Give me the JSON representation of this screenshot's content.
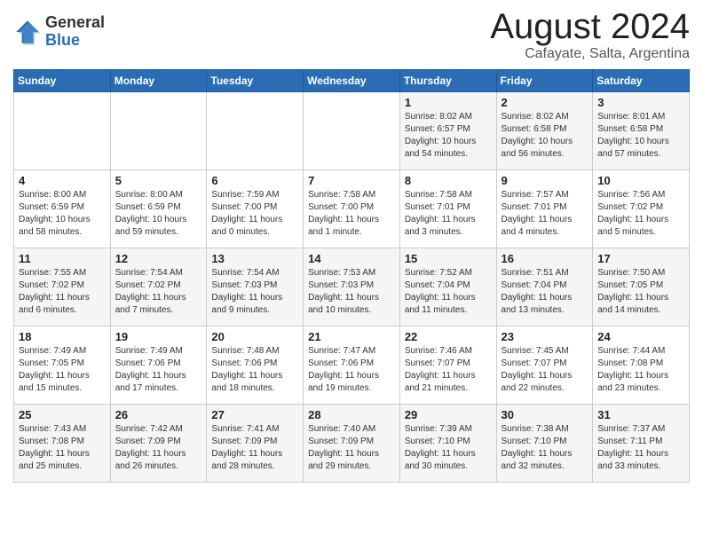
{
  "header": {
    "logo_general": "General",
    "logo_blue": "Blue",
    "month_title": "August 2024",
    "location": "Cafayate, Salta, Argentina"
  },
  "weekdays": [
    "Sunday",
    "Monday",
    "Tuesday",
    "Wednesday",
    "Thursday",
    "Friday",
    "Saturday"
  ],
  "weeks": [
    [
      {
        "day": "",
        "detail": ""
      },
      {
        "day": "",
        "detail": ""
      },
      {
        "day": "",
        "detail": ""
      },
      {
        "day": "",
        "detail": ""
      },
      {
        "day": "1",
        "detail": "Sunrise: 8:02 AM\nSunset: 6:57 PM\nDaylight: 10 hours\nand 54 minutes."
      },
      {
        "day": "2",
        "detail": "Sunrise: 8:02 AM\nSunset: 6:58 PM\nDaylight: 10 hours\nand 56 minutes."
      },
      {
        "day": "3",
        "detail": "Sunrise: 8:01 AM\nSunset: 6:58 PM\nDaylight: 10 hours\nand 57 minutes."
      }
    ],
    [
      {
        "day": "4",
        "detail": "Sunrise: 8:00 AM\nSunset: 6:59 PM\nDaylight: 10 hours\nand 58 minutes."
      },
      {
        "day": "5",
        "detail": "Sunrise: 8:00 AM\nSunset: 6:59 PM\nDaylight: 10 hours\nand 59 minutes."
      },
      {
        "day": "6",
        "detail": "Sunrise: 7:59 AM\nSunset: 7:00 PM\nDaylight: 11 hours\nand 0 minutes."
      },
      {
        "day": "7",
        "detail": "Sunrise: 7:58 AM\nSunset: 7:00 PM\nDaylight: 11 hours\nand 1 minute."
      },
      {
        "day": "8",
        "detail": "Sunrise: 7:58 AM\nSunset: 7:01 PM\nDaylight: 11 hours\nand 3 minutes."
      },
      {
        "day": "9",
        "detail": "Sunrise: 7:57 AM\nSunset: 7:01 PM\nDaylight: 11 hours\nand 4 minutes."
      },
      {
        "day": "10",
        "detail": "Sunrise: 7:56 AM\nSunset: 7:02 PM\nDaylight: 11 hours\nand 5 minutes."
      }
    ],
    [
      {
        "day": "11",
        "detail": "Sunrise: 7:55 AM\nSunset: 7:02 PM\nDaylight: 11 hours\nand 6 minutes."
      },
      {
        "day": "12",
        "detail": "Sunrise: 7:54 AM\nSunset: 7:02 PM\nDaylight: 11 hours\nand 7 minutes."
      },
      {
        "day": "13",
        "detail": "Sunrise: 7:54 AM\nSunset: 7:03 PM\nDaylight: 11 hours\nand 9 minutes."
      },
      {
        "day": "14",
        "detail": "Sunrise: 7:53 AM\nSunset: 7:03 PM\nDaylight: 11 hours\nand 10 minutes."
      },
      {
        "day": "15",
        "detail": "Sunrise: 7:52 AM\nSunset: 7:04 PM\nDaylight: 11 hours\nand 11 minutes."
      },
      {
        "day": "16",
        "detail": "Sunrise: 7:51 AM\nSunset: 7:04 PM\nDaylight: 11 hours\nand 13 minutes."
      },
      {
        "day": "17",
        "detail": "Sunrise: 7:50 AM\nSunset: 7:05 PM\nDaylight: 11 hours\nand 14 minutes."
      }
    ],
    [
      {
        "day": "18",
        "detail": "Sunrise: 7:49 AM\nSunset: 7:05 PM\nDaylight: 11 hours\nand 15 minutes."
      },
      {
        "day": "19",
        "detail": "Sunrise: 7:49 AM\nSunset: 7:06 PM\nDaylight: 11 hours\nand 17 minutes."
      },
      {
        "day": "20",
        "detail": "Sunrise: 7:48 AM\nSunset: 7:06 PM\nDaylight: 11 hours\nand 18 minutes."
      },
      {
        "day": "21",
        "detail": "Sunrise: 7:47 AM\nSunset: 7:06 PM\nDaylight: 11 hours\nand 19 minutes."
      },
      {
        "day": "22",
        "detail": "Sunrise: 7:46 AM\nSunset: 7:07 PM\nDaylight: 11 hours\nand 21 minutes."
      },
      {
        "day": "23",
        "detail": "Sunrise: 7:45 AM\nSunset: 7:07 PM\nDaylight: 11 hours\nand 22 minutes."
      },
      {
        "day": "24",
        "detail": "Sunrise: 7:44 AM\nSunset: 7:08 PM\nDaylight: 11 hours\nand 23 minutes."
      }
    ],
    [
      {
        "day": "25",
        "detail": "Sunrise: 7:43 AM\nSunset: 7:08 PM\nDaylight: 11 hours\nand 25 minutes."
      },
      {
        "day": "26",
        "detail": "Sunrise: 7:42 AM\nSunset: 7:09 PM\nDaylight: 11 hours\nand 26 minutes."
      },
      {
        "day": "27",
        "detail": "Sunrise: 7:41 AM\nSunset: 7:09 PM\nDaylight: 11 hours\nand 28 minutes."
      },
      {
        "day": "28",
        "detail": "Sunrise: 7:40 AM\nSunset: 7:09 PM\nDaylight: 11 hours\nand 29 minutes."
      },
      {
        "day": "29",
        "detail": "Sunrise: 7:39 AM\nSunset: 7:10 PM\nDaylight: 11 hours\nand 30 minutes."
      },
      {
        "day": "30",
        "detail": "Sunrise: 7:38 AM\nSunset: 7:10 PM\nDaylight: 11 hours\nand 32 minutes."
      },
      {
        "day": "31",
        "detail": "Sunrise: 7:37 AM\nSunset: 7:11 PM\nDaylight: 11 hours\nand 33 minutes."
      }
    ]
  ]
}
